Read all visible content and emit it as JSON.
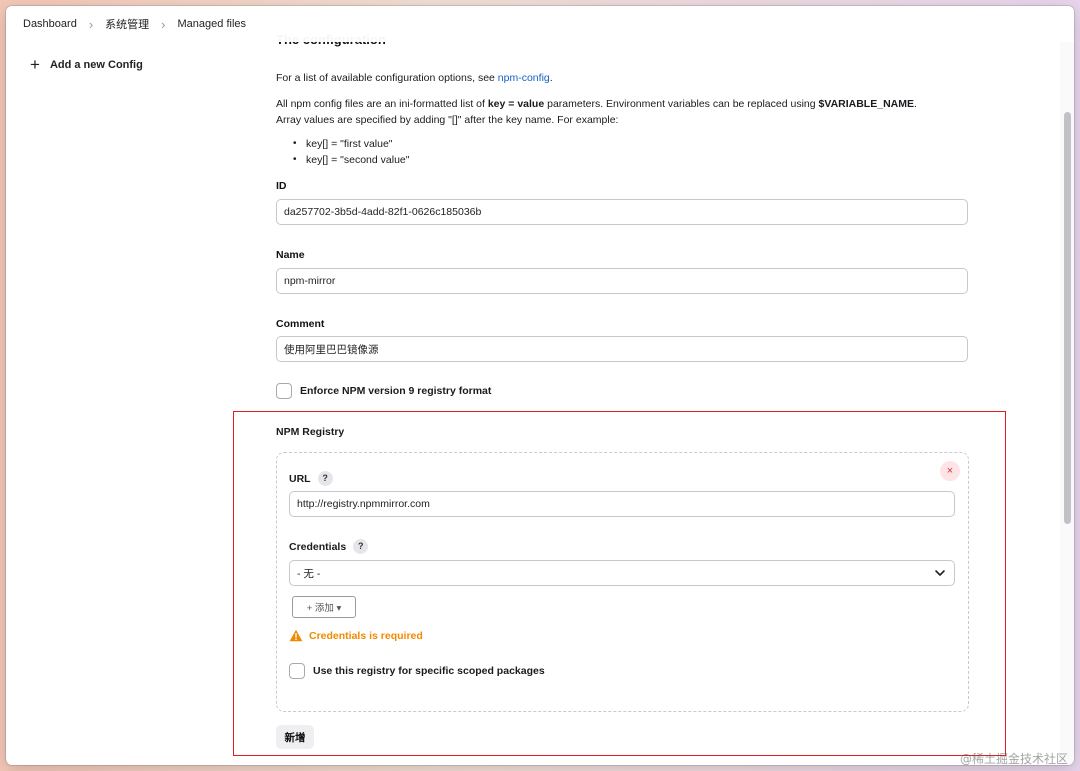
{
  "breadcrumb": {
    "items": [
      "Dashboard",
      "系统管理",
      "Managed files"
    ]
  },
  "sidebar": {
    "add_config_label": "Add a new Config"
  },
  "page": {
    "section_title": "The configuration",
    "intro_prefix": "For a list of available configuration options, see ",
    "intro_link": "npm-config",
    "intro_suffix": ".",
    "para2_a": "All npm config files are an ini-formatted list of ",
    "para2_b": "key = value",
    "para2_c": " parameters. Environment variables can be replaced using ",
    "para2_d": "$VARIABLE_NAME",
    "para2_e": ".",
    "para3": "Array values are specified by adding \"[]\" after the key name. For example:",
    "bullets": [
      "key[] = \"first value\"",
      "key[] = \"second value\""
    ]
  },
  "form": {
    "id_label": "ID",
    "id_value": "da257702-3b5d-4add-82f1-0626c185036b",
    "name_label": "Name",
    "name_value": "npm-mirror",
    "comment_label": "Comment",
    "comment_value": "使用阿里巴巴镜像源",
    "enforce_label": "Enforce NPM version 9 registry format",
    "enforce_checked": false
  },
  "registry": {
    "title": "NPM Registry",
    "close_symbol": "×",
    "help_symbol": "?",
    "url_label": "URL",
    "url_value": "http://registry.npmmirror.com",
    "credentials_label": "Credentials",
    "credentials_selected": "- 无 -",
    "add_button_label": "+ 添加 ▾",
    "warning_text": "Credentials is required",
    "scoped_label": "Use this registry for specific scoped packages",
    "scoped_checked": false
  },
  "actions": {
    "submit_label": "新增"
  },
  "watermark": "@稀土掘金技术社区",
  "colors": {
    "link": "#1561c4",
    "warning": "#f08a00",
    "highlight_border": "#e02020",
    "close": "#e0303c"
  }
}
